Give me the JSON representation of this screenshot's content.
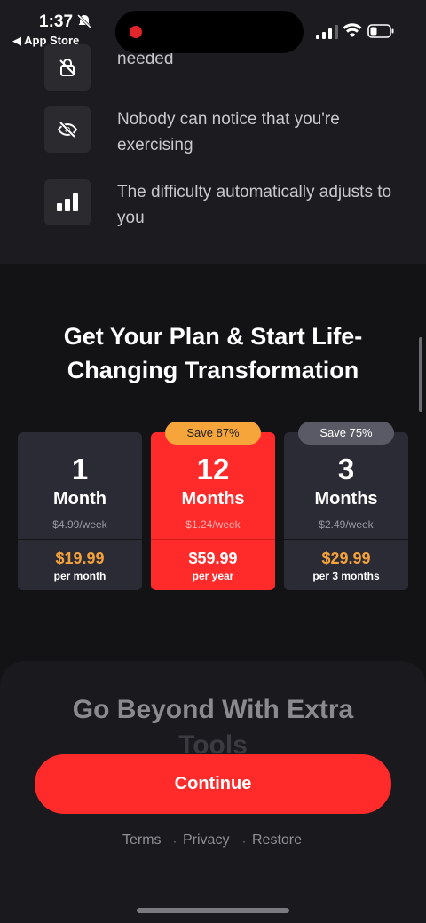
{
  "status_bar": {
    "time": "1:37",
    "back_app": "◀ App Store"
  },
  "features": [
    {
      "icon": "lock-icon",
      "text": "No special equipment is needed",
      "visible_text": "needed"
    },
    {
      "icon": "eye-off-icon",
      "text": "Nobody can notice that you're exercising"
    },
    {
      "icon": "bar-chart-icon",
      "text": "The difficulty automatically adjusts to you"
    }
  ],
  "plan": {
    "title": "Get Your Plan & Start Life-Changing Transformation",
    "cards": [
      {
        "num": "1",
        "unit": "Month",
        "weekly": "$4.99/week",
        "price": "$19.99",
        "period": "per month",
        "badge": "",
        "selected": false
      },
      {
        "num": "12",
        "unit": "Months",
        "weekly": "$1.24/week",
        "price": "$59.99",
        "period": "per year",
        "badge": "Save 87%",
        "selected": true
      },
      {
        "num": "3",
        "unit": "Months",
        "weekly": "$2.49/week",
        "price": "$29.99",
        "period": "per 3 months",
        "badge": "Save 75%",
        "selected": false
      }
    ]
  },
  "extra": {
    "title_line1": "Go Beyond With Extra",
    "title_line2": "Tools"
  },
  "continue_label": "Continue",
  "links": {
    "terms": "Terms",
    "privacy": "Privacy",
    "restore": "Restore",
    "sep": "·"
  },
  "colors": {
    "accent": "#ff2a2a",
    "price": "#f5a23a",
    "card_bg": "#2a2b35",
    "bg": "#131316"
  }
}
